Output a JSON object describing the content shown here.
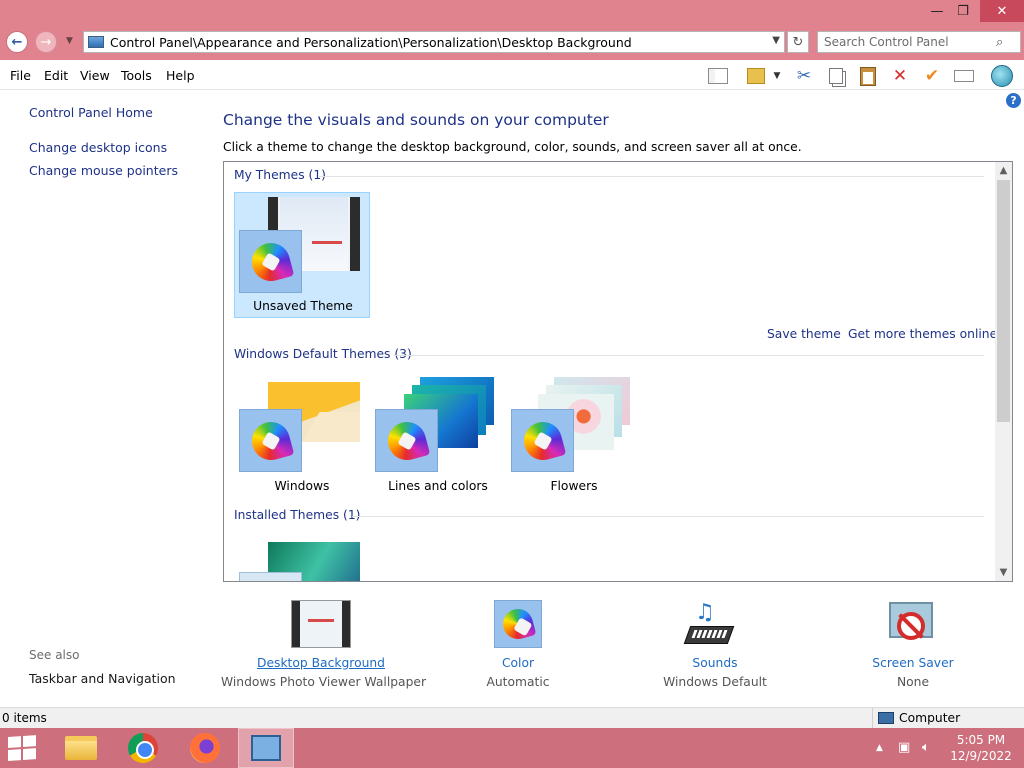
{
  "window": {
    "minimize": "—",
    "maximize": "❐",
    "close": "✕"
  },
  "address": {
    "path": "Control Panel\\Appearance and Personalization\\Personalization\\Desktop Background",
    "search_placeholder": "Search Control Panel"
  },
  "menu": [
    "File",
    "Edit",
    "View",
    "Tools",
    "Help"
  ],
  "toolbar_icons": [
    "layout-pane-icon",
    "properties-folder-icon",
    "cut-icon",
    "copy-icon",
    "paste-icon",
    "delete-icon",
    "check-icon",
    "rename-icon",
    "globe-icon"
  ],
  "left_nav": {
    "home": "Control Panel Home",
    "desktop_icons": "Change desktop icons",
    "mouse_pointers": "Change mouse pointers",
    "see_also": "See also",
    "taskbar": "Taskbar and Navigation"
  },
  "main": {
    "title": "Change the visuals and sounds on your computer",
    "subtitle": "Click a theme to change the desktop background, color, sounds, and screen saver all at once."
  },
  "groups": {
    "my_themes": "My Themes (1)",
    "default_themes": "Windows Default Themes (3)",
    "installed_themes": "Installed Themes (1)"
  },
  "themes": {
    "unsaved": "Unsaved Theme",
    "windows": "Windows",
    "lines": "Lines and colors",
    "flowers": "Flowers"
  },
  "links": {
    "save_theme": "Save theme",
    "get_more": "Get more themes online"
  },
  "settings": {
    "background_label": "Desktop Background",
    "background_value": "Windows Photo Viewer Wallpaper",
    "color_label": "Color",
    "color_value": "Automatic",
    "sounds_label": "Sounds",
    "sounds_value": "Windows Default",
    "saver_label": "Screen Saver",
    "saver_value": "None"
  },
  "status": {
    "items": "0 items",
    "location": "Computer"
  },
  "clock": {
    "time": "5:05 PM",
    "date": "12/9/2022"
  },
  "colors": {
    "titlebar": "#e0838e",
    "taskbar": "#cd6f7c",
    "link": "#1e3287",
    "selected": "#cce8ff"
  }
}
